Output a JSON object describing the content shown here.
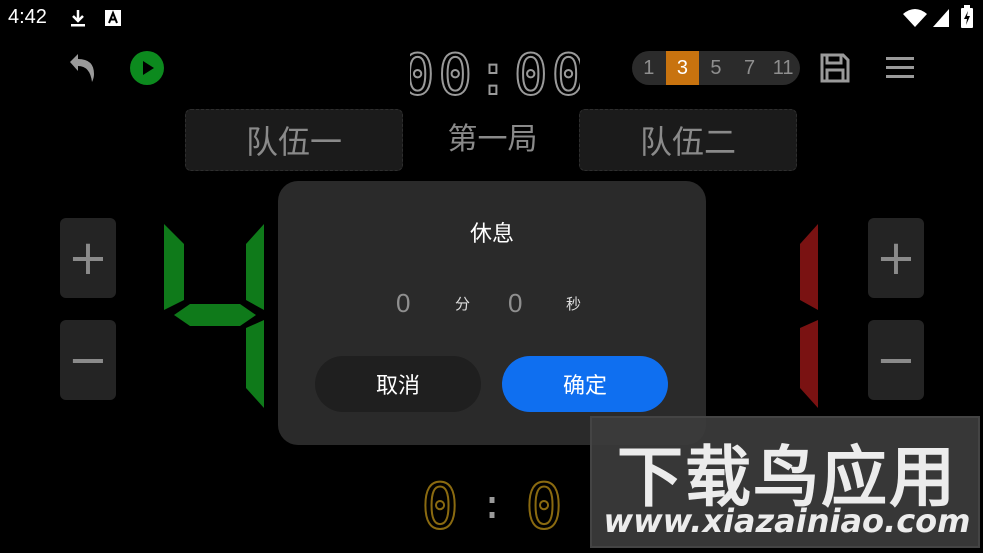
{
  "status_bar": {
    "time": "4:42",
    "icons": [
      "download-icon",
      "app-notification-icon",
      "wifi-icon",
      "signal-icon",
      "battery-charging-icon"
    ]
  },
  "toolbar": {
    "timer": "00:00",
    "sets": [
      "1",
      "3",
      "5",
      "7",
      "11"
    ],
    "sets_selected": "3",
    "icons": [
      "undo-icon",
      "play-icon",
      "save-icon",
      "menu-icon"
    ]
  },
  "teams": {
    "left": "队伍一",
    "right": "队伍二"
  },
  "round_label": "第一局",
  "controls": {
    "plus": "+",
    "minus": "−"
  },
  "scores": {
    "left": "4",
    "right": "1"
  },
  "sets_score": {
    "left": "0",
    "separator": ":",
    "right": "0"
  },
  "dialog": {
    "title": "休息",
    "minutes_value": "0",
    "minutes_unit": "分",
    "seconds_value": "0",
    "seconds_unit": "秒",
    "cancel_label": "取消",
    "confirm_label": "确定"
  },
  "watermark": {
    "title": "下载鸟应用",
    "url": "www.xiazainiao.com"
  },
  "colors": {
    "accent_blue": "#0f6ff0",
    "set_active": "#c8730f",
    "left_score": "#0f7a1a",
    "right_score": "#7a1212",
    "sets_score": "#8a6a10"
  }
}
